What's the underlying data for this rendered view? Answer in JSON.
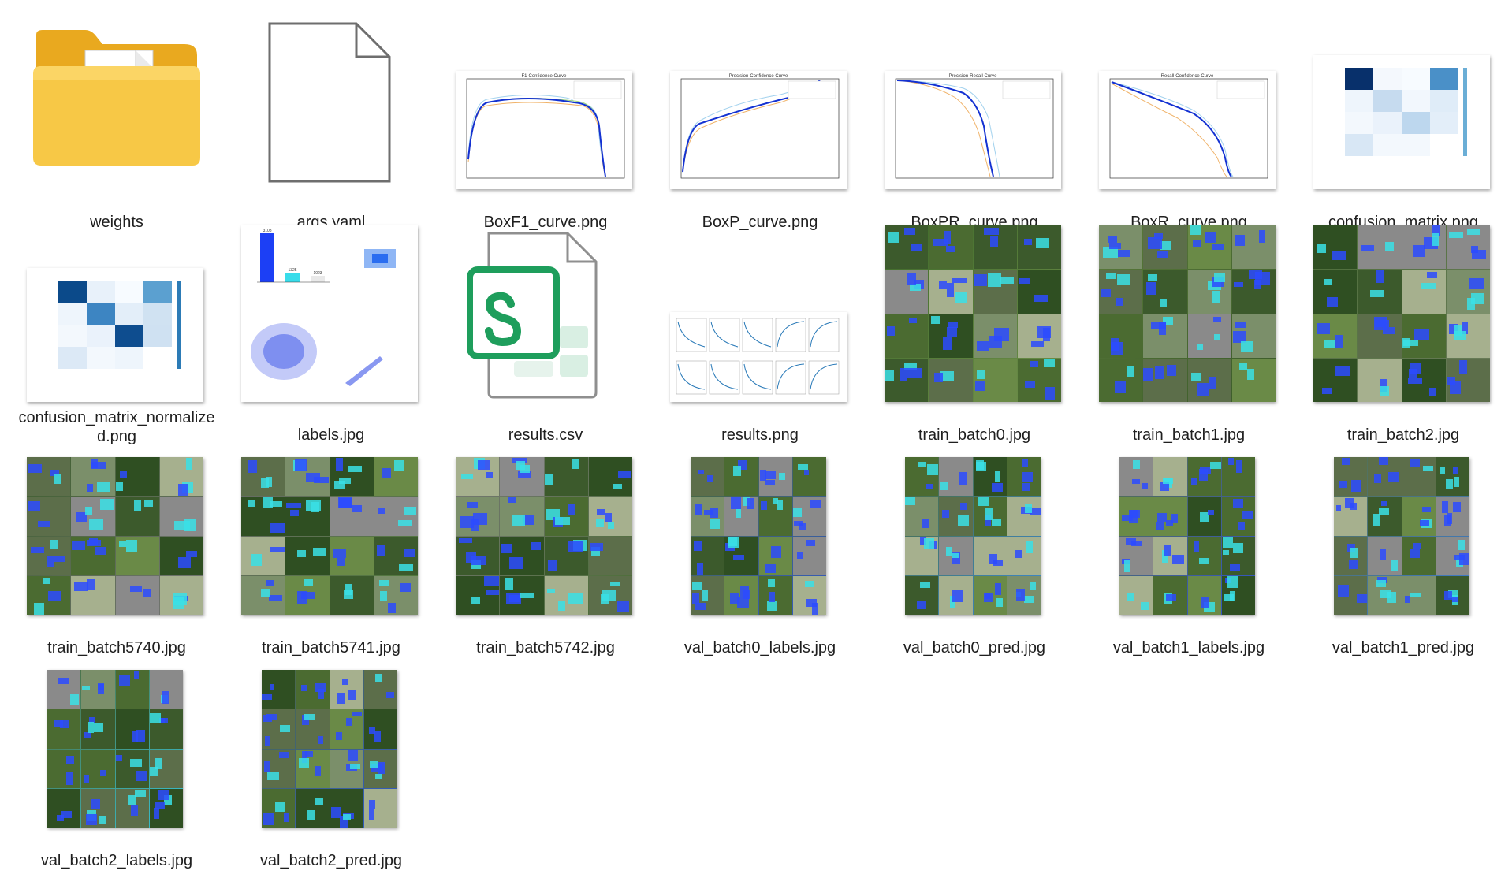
{
  "files": [
    {
      "name": "weights",
      "icon": "folder-icon"
    },
    {
      "name": "args.yaml",
      "icon": "blank-file-icon"
    },
    {
      "name": "BoxF1_curve.png",
      "icon": "image-thumbnail"
    },
    {
      "name": "BoxP_curve.png",
      "icon": "image-thumbnail"
    },
    {
      "name": "BoxPR_curve.png",
      "icon": "image-thumbnail"
    },
    {
      "name": "BoxR_curve.png",
      "icon": "image-thumbnail"
    },
    {
      "name": "confusion_matrix.png",
      "icon": "image-thumbnail"
    },
    {
      "name": "confusion_matrix_normalized.png",
      "icon": "image-thumbnail"
    },
    {
      "name": "labels.jpg",
      "icon": "image-thumbnail"
    },
    {
      "name": "results.csv",
      "icon": "spreadsheet-icon"
    },
    {
      "name": "results.png",
      "icon": "image-thumbnail"
    },
    {
      "name": "train_batch0.jpg",
      "icon": "image-thumbnail"
    },
    {
      "name": "train_batch1.jpg",
      "icon": "image-thumbnail"
    },
    {
      "name": "train_batch2.jpg",
      "icon": "image-thumbnail"
    },
    {
      "name": "train_batch5740.jpg",
      "icon": "image-thumbnail"
    },
    {
      "name": "train_batch5741.jpg",
      "icon": "image-thumbnail"
    },
    {
      "name": "train_batch5742.jpg",
      "icon": "image-thumbnail"
    },
    {
      "name": "val_batch0_labels.jpg",
      "icon": "image-thumbnail"
    },
    {
      "name": "val_batch0_pred.jpg",
      "icon": "image-thumbnail"
    },
    {
      "name": "val_batch1_labels.jpg",
      "icon": "image-thumbnail"
    },
    {
      "name": "val_batch1_pred.jpg",
      "icon": "image-thumbnail"
    },
    {
      "name": "val_batch2_labels.jpg",
      "icon": "image-thumbnail"
    },
    {
      "name": "val_batch2_pred.jpg",
      "icon": "image-thumbnail"
    }
  ],
  "chart_thumbs": {
    "f1": {
      "title": "F1-Confidence Curve"
    },
    "p": {
      "title": "Precision-Confidence Curve"
    },
    "pr": {
      "title": "Precision-Recall Curve"
    },
    "r": {
      "title": "Recall-Confidence Curve"
    }
  },
  "labels_thumb": {
    "bar_values": [
      "3108",
      "1325",
      "1023"
    ]
  },
  "colors": {
    "folder": "#f5c24a",
    "excel": "#1e9e5c",
    "box_blue": "#2b4bff",
    "box_cyan": "#39e1e6"
  }
}
